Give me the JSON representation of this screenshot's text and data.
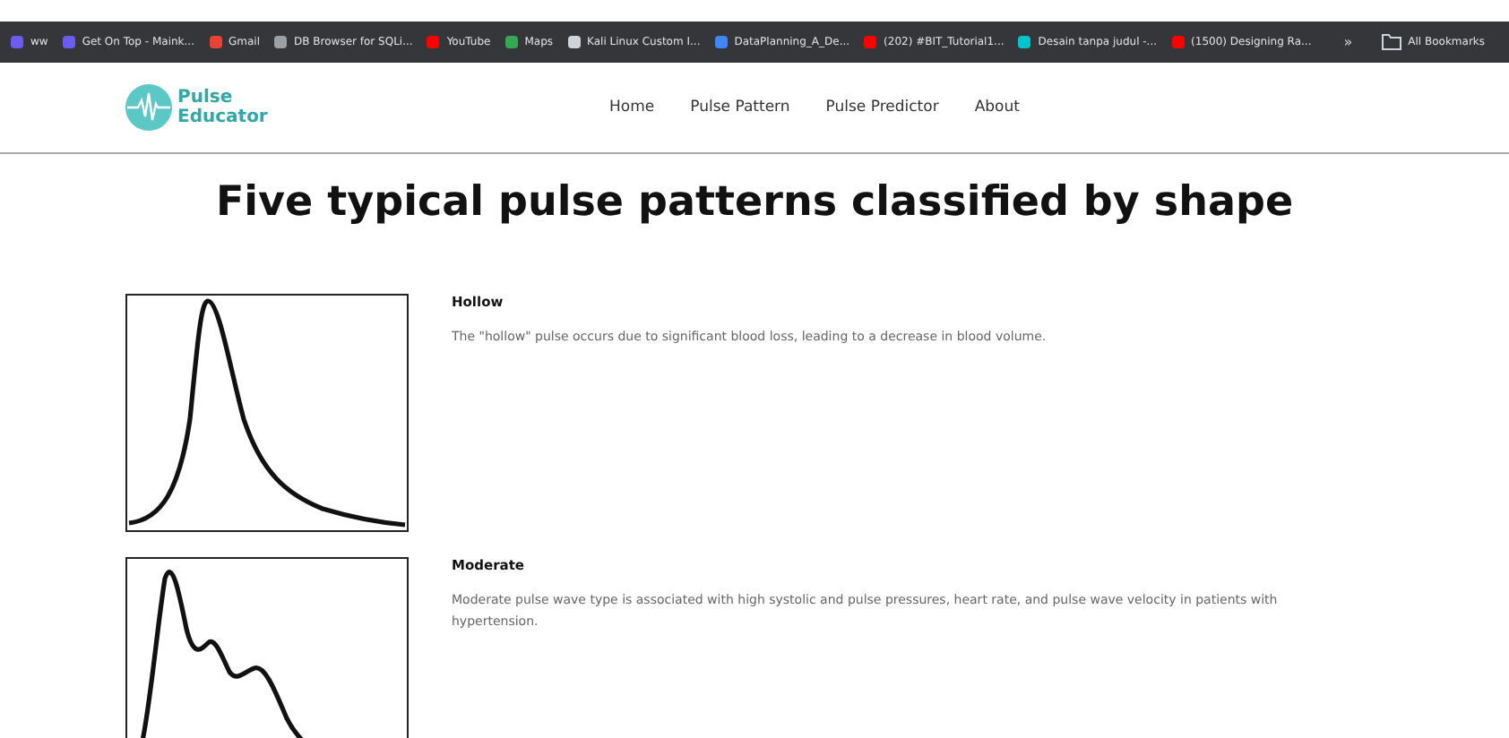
{
  "bookmarks": [
    {
      "label": "ww",
      "color": "#6b5cf0"
    },
    {
      "label": "Get On Top - Maink...",
      "color": "#6b5cf0"
    },
    {
      "label": "Gmail",
      "color": "#ea4335"
    },
    {
      "label": "DB Browser for SQLi...",
      "color": "#9aa0a6"
    },
    {
      "label": "YouTube",
      "color": "#ff0000"
    },
    {
      "label": "Maps",
      "color": "#34a853"
    },
    {
      "label": "Kali Linux Custom I...",
      "color": "#cfd4dc"
    },
    {
      "label": "DataPlanning_A_De...",
      "color": "#4285f4"
    },
    {
      "label": "(202) #BIT_Tutorial1...",
      "color": "#ff0000"
    },
    {
      "label": "Desain tanpa judul -...",
      "color": "#00c4cc"
    },
    {
      "label": "(1500) Designing Ra...",
      "color": "#ff0000"
    }
  ],
  "bookmarks_more": "»",
  "all_bookmarks": "All Bookmarks",
  "brand": {
    "line_1": "Pulse",
    "line_2": "Educator"
  },
  "nav": [
    {
      "label": "Home"
    },
    {
      "label": "Pulse Pattern"
    },
    {
      "label": "Pulse Predictor"
    },
    {
      "label": "About"
    }
  ],
  "title": "Five typical pulse patterns classified by shape",
  "patterns": [
    {
      "kind": "hollow",
      "name": "Hollow",
      "description": "The \"hollow\" pulse occurs due to significant blood loss, leading to a decrease in blood volume."
    },
    {
      "kind": "moderate",
      "name": "Moderate",
      "description": "Moderate pulse wave type is associated with high systolic and pulse pressures, heart rate, and pulse wave velocity in patients with hypertension."
    }
  ]
}
